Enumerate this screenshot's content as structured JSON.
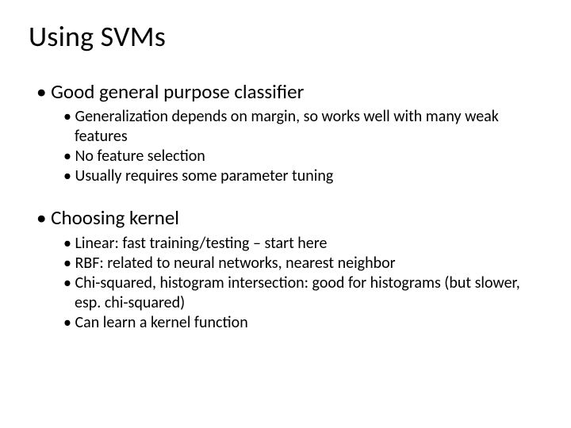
{
  "title": "Using SVMs",
  "sections": [
    {
      "heading": "Good general purpose classifier",
      "items": [
        "Generalization depends on margin, so works well with many weak features",
        "No feature selection",
        "Usually requires some parameter tuning"
      ]
    },
    {
      "heading": "Choosing kernel",
      "items": [
        "Linear: fast training/testing – start here",
        "RBF: related to neural networks, nearest neighbor",
        "Chi-squared, histogram intersection: good for histograms (but slower, esp. chi-squared)",
        "Can learn a kernel function"
      ]
    }
  ]
}
